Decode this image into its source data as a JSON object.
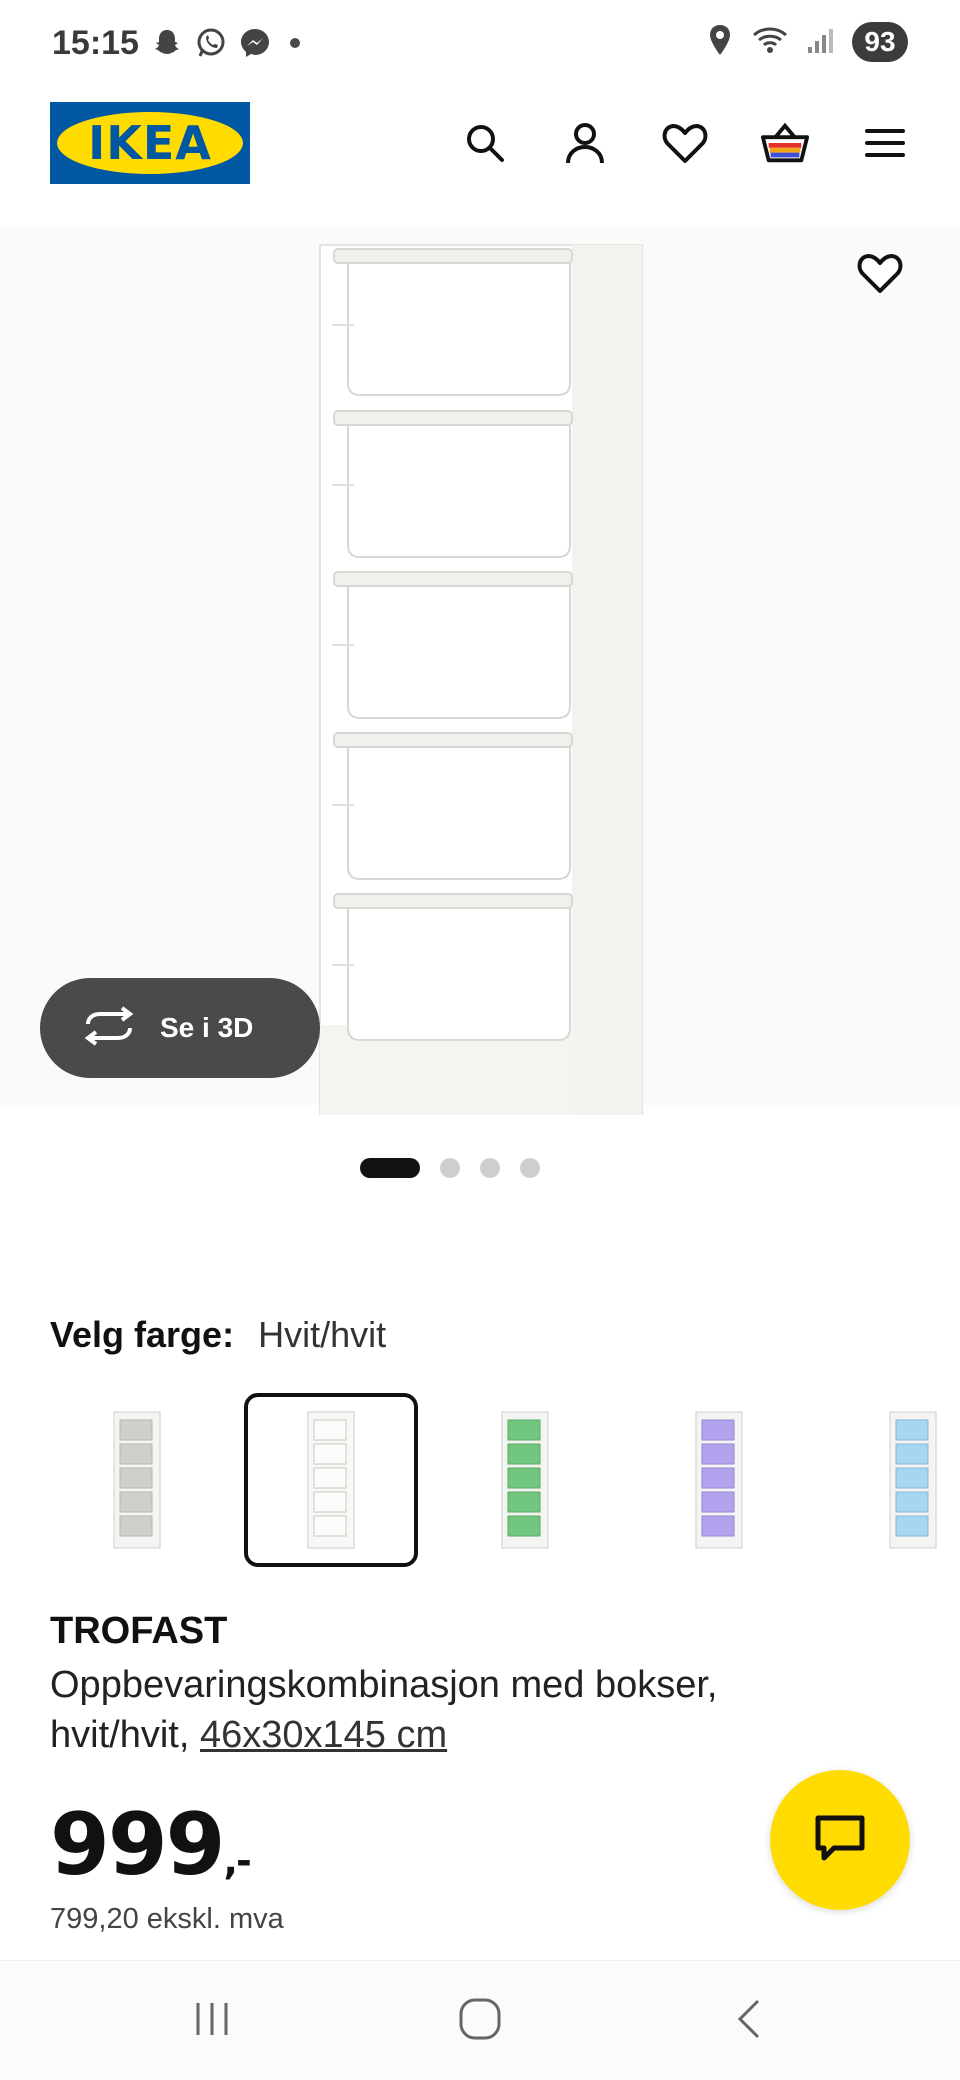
{
  "status_bar": {
    "time": "15:15",
    "battery": "93",
    "left_icons": [
      "snapchat-icon",
      "whatsapp-icon",
      "messenger-icon"
    ],
    "right_icons": [
      "location-icon",
      "wifi-icon",
      "signal-icon"
    ]
  },
  "header": {
    "logo_text": "IKEA",
    "icons": [
      "search-icon",
      "profile-icon",
      "heart-icon",
      "basket-icon",
      "menu-icon"
    ]
  },
  "gallery": {
    "view3d_label": "Se i 3D",
    "image_count": 4,
    "active_index": 0
  },
  "color_selector": {
    "label": "Velg farge:",
    "selected_value": "Hvit/hvit",
    "swatches": [
      {
        "color": "#d8d8d6",
        "selected": false
      },
      {
        "color": "#f4f4f2",
        "selected": true
      },
      {
        "color": "#7fd08a",
        "selected": false
      },
      {
        "color": "#b9a8f0",
        "selected": false
      },
      {
        "color": "#a8d8f0",
        "selected": false
      }
    ]
  },
  "product": {
    "name": "TROFAST",
    "description": "Oppbevaringskombinasjon med bokser, hvit/hvit,",
    "measurement": "46x30x145 cm",
    "price_main": "999",
    "price_suffix": ",-",
    "price_excl_vat": "799,20 ekskl. mva"
  },
  "colors": {
    "brand_blue": "#0058a3",
    "brand_yellow": "#ffdb00",
    "dark_pill": "#4a4a4a"
  }
}
